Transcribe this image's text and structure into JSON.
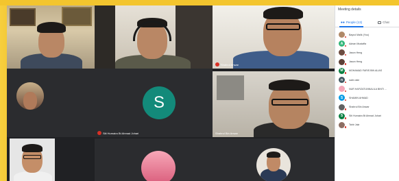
{
  "meeting": {
    "panel_title": "Meeting details",
    "tabs": [
      {
        "label": "People (13)",
        "active": true,
        "icon": "people-icon"
      },
      {
        "label": "Chat",
        "active": false,
        "icon": "chat-icon"
      }
    ],
    "participants": [
      {
        "name": "Bayrul Malik (You)",
        "initial": "",
        "color": "#b08968"
      },
      {
        "name": "Adnan Mustaffa",
        "initial": "A",
        "color": "#33b679"
      },
      {
        "name": "Jason Heng",
        "initial": "",
        "color": "#6d4c41"
      },
      {
        "name": "Jason Heng",
        "initial": "",
        "color": "#5d4037"
      },
      {
        "name": "MOHAMAD FARIS BIN ALIAS",
        "initial": "M",
        "color": "#0b8043"
      },
      {
        "name": "nalin okie",
        "initial": "n",
        "color": "#455a64"
      },
      {
        "name": "NUR HAFIZATUNNALILA BINTI ...",
        "initial": "",
        "color": "#f4a7b9"
      },
      {
        "name": "SHAMIN AHMAD",
        "initial": "S",
        "color": "#039be5"
      },
      {
        "name": "Shahrul Bin Anwar",
        "initial": "",
        "color": "#616161"
      },
      {
        "name": "Siti Humaira Bt Ahmad Johari",
        "initial": "S",
        "color": "#0b8043"
      },
      {
        "name": "Tahir Jala",
        "initial": "",
        "color": "#8d6e63"
      }
    ]
  },
  "tiles": {
    "t3_name": "Shahrul Anwar",
    "t5_name": "Siti Humaira Bt Ahmad Johari",
    "t5_initial": "S",
    "t6_name": "Shahrul Bin Anwar",
    "colors": {
      "avatar_teal": "#138a7a",
      "mute_red": "#d93025",
      "frame_yellow": "#f1c02c"
    }
  }
}
